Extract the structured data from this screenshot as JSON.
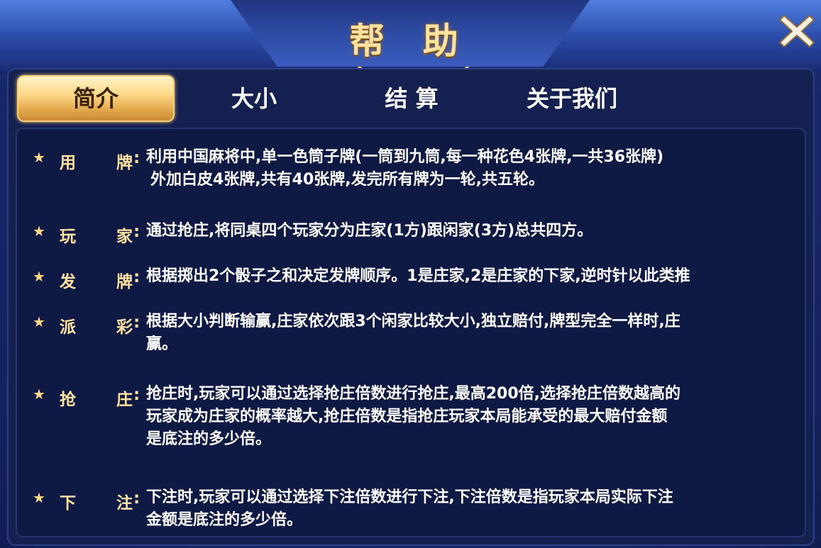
{
  "dialog": {
    "title": "帮 助"
  },
  "tabs": [
    {
      "label": "简介",
      "active": true
    },
    {
      "label": "大小",
      "active": false
    },
    {
      "label": "结 算",
      "active": false
    },
    {
      "label": "关于我们",
      "active": false
    }
  ],
  "rules": [
    {
      "label_a": "用",
      "label_b": "牌",
      "colon": ":",
      "lines": [
        "利用中国麻将中,单一色筒子牌(一筒到九筒,每一种花色4张牌,一共36张牌)",
        "外加白皮4张牌,共有40张牌,发完所有牌为一轮,共五轮。"
      ]
    },
    {
      "label_a": "玩",
      "label_b": "家",
      "colon": ":",
      "lines": [
        "通过抢庄,将同桌四个玩家分为庄家(1方)跟闲家(3方)总共四方。"
      ]
    },
    {
      "label_a": "发",
      "label_b": "牌",
      "colon": ":",
      "lines": [
        "根据掷出2个骰子之和决定发牌顺序。1是庄家,2是庄家的下家,逆时针以此类推"
      ]
    },
    {
      "label_a": "派",
      "label_b": "彩",
      "colon": ":",
      "lines": [
        "根据大小判断输赢,庄家依次跟3个闲家比较大小,独立赔付,牌型完全一样时,庄",
        "赢。"
      ]
    },
    {
      "label_a": "抢",
      "label_b": "庄",
      "colon": ":",
      "lines": [
        "抢庄时,玩家可以通过选择抢庄倍数进行抢庄,最高200倍,选择抢庄倍数越高的",
        "玩家成为庄家的概率越大,抢庄倍数是指抢庄玩家本局能承受的最大赔付金额",
        "是底注的多少倍。"
      ]
    },
    {
      "label_a": "下",
      "label_b": "注",
      "colon": ":",
      "lines": [
        "下注时,玩家可以通过选择下注倍数进行下注,下注倍数是指玩家本局实际下注",
        "金额是底注的多少倍。"
      ]
    }
  ],
  "icons": {
    "close": "close-icon",
    "bullet": "star-icon"
  },
  "colors": {
    "accent_gold": "#ffd98a",
    "panel_bg": "#0f1a44",
    "text": "#ffffff"
  }
}
